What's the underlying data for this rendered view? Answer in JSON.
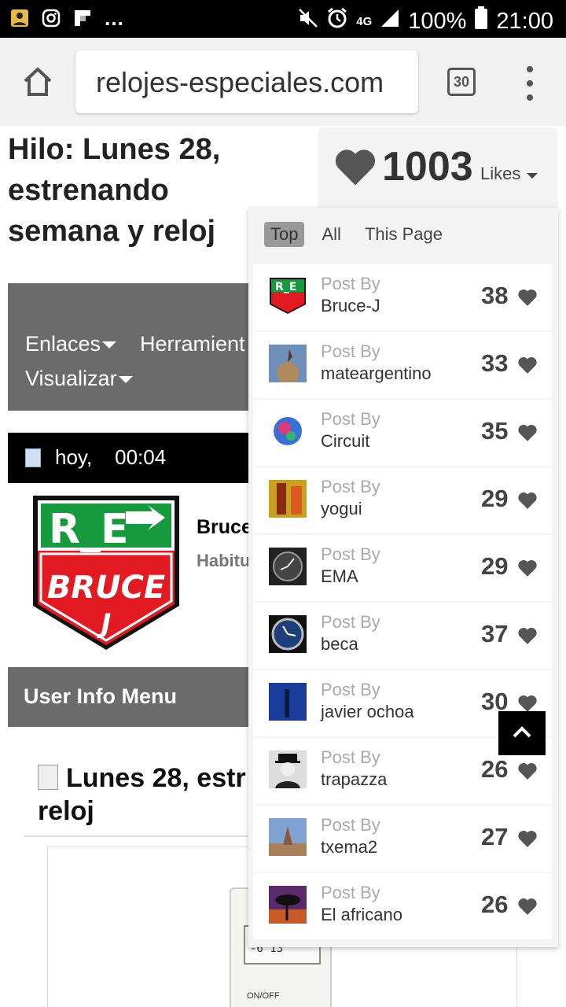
{
  "status": {
    "battery": "100%",
    "time": "21:00",
    "network": "4G"
  },
  "browser": {
    "url": "relojes-especiales.com",
    "tab_count": "30"
  },
  "thread": {
    "title": "Hilo: Lunes 28, estrenando semana y reloj",
    "nav_items": [
      "Enlaces",
      "Herramient",
      "Visualizar"
    ],
    "post_date": "hoy,",
    "post_time": "00:04",
    "post_user": "Bruce",
    "post_rank": "Habitu",
    "user_info_menu": "User Info Menu",
    "post_title": "Lunes 28, estr reloj",
    "avatar_text": {
      "top": "R_E",
      "middle": "BRUCE",
      "bottom": "J"
    },
    "device_display": "-6 13",
    "device_key": "ON/OFF"
  },
  "likes": {
    "count": "1003",
    "label": "Likes",
    "filters": [
      "Top",
      "All",
      "This Page"
    ],
    "active_filter": "Top",
    "entries": [
      {
        "label": "Post By",
        "user": "Bruce-J",
        "count": "38"
      },
      {
        "label": "Post By",
        "user": "mateargentino",
        "count": "33"
      },
      {
        "label": "Post By",
        "user": "Circuit",
        "count": "35"
      },
      {
        "label": "Post By",
        "user": "yogui",
        "count": "29"
      },
      {
        "label": "Post By",
        "user": "EMA",
        "count": "29"
      },
      {
        "label": "Post By",
        "user": "beca",
        "count": "37"
      },
      {
        "label": "Post By",
        "user": "javier ochoa",
        "count": "30"
      },
      {
        "label": "Post By",
        "user": "trapazza",
        "count": "26"
      },
      {
        "label": "Post By",
        "user": "txema2",
        "count": "27"
      },
      {
        "label": "Post By",
        "user": "El africano",
        "count": "26"
      }
    ]
  }
}
